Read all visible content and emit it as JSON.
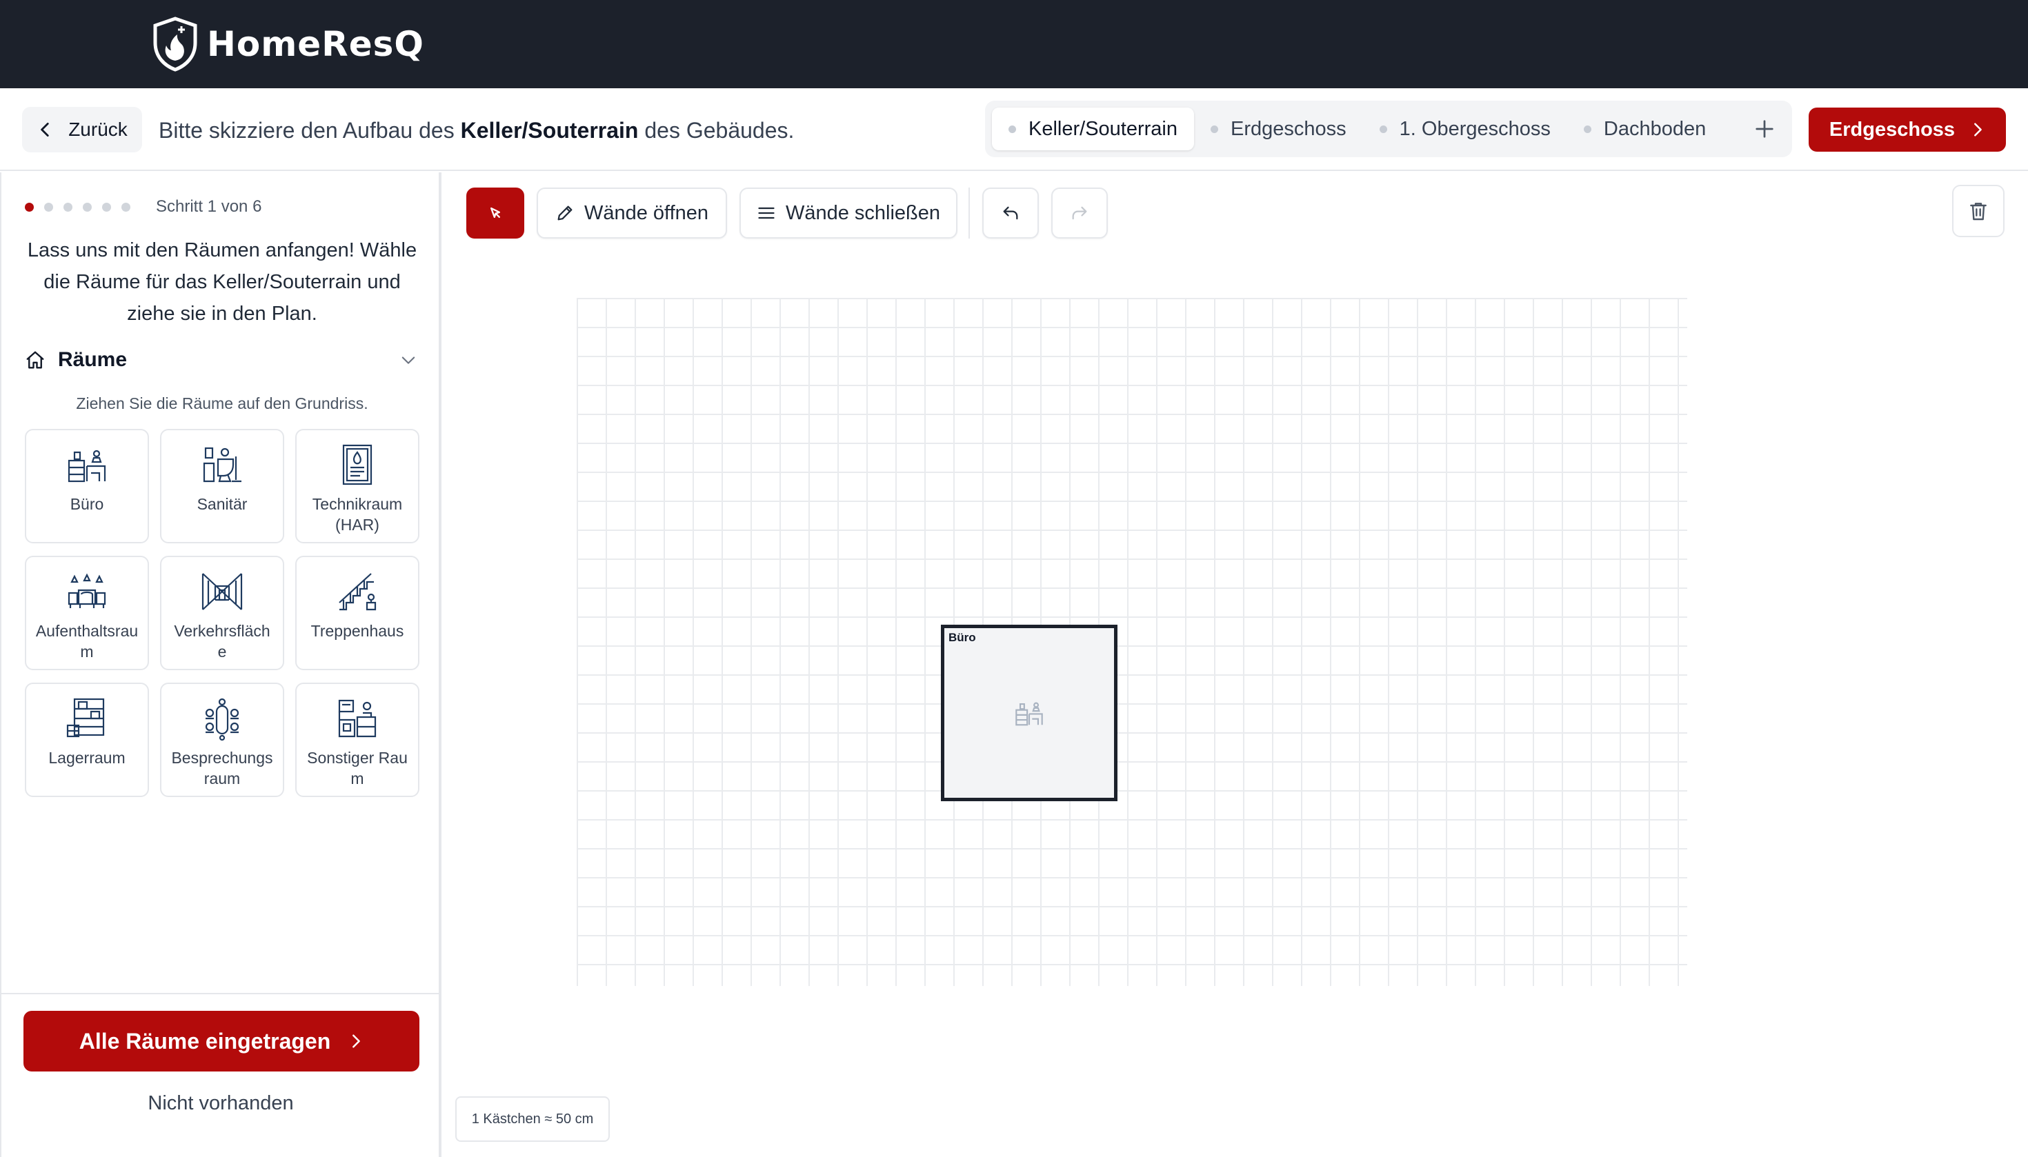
{
  "app": {
    "name": "HomeResQ"
  },
  "header": {
    "back_label": "Zurück",
    "prompt_before": "Bitte skizziere den Aufbau des ",
    "prompt_floor": "Keller/Souterrain",
    "prompt_after": " des Gebäudes.",
    "floors": [
      "Keller/Souterrain",
      "Erdgeschoss",
      "1. Obergeschoss",
      "Dachboden"
    ],
    "active_floor": "Keller/Souterrain",
    "next_label": "Erdgeschoss"
  },
  "sidebar": {
    "step_text": "Schritt 1 von 6",
    "step_current": 1,
    "step_total": 6,
    "intro": "Lass uns mit den Räumen anfangen! Wähle die Räume für das Keller/Souterrain und ziehe sie in den Plan.",
    "section_title": "Räume",
    "hint": "Ziehen Sie die Räume auf den Grundriss.",
    "rooms": [
      {
        "label": "Büro",
        "icon": "office-icon"
      },
      {
        "label": "Sanitär",
        "icon": "sanitary-icon"
      },
      {
        "label": "Technikraum (HAR)",
        "icon": "technical-room-icon"
      },
      {
        "label": "Aufenthaltsraum",
        "icon": "lounge-icon"
      },
      {
        "label": "Verkehrsfläche",
        "icon": "corridor-icon"
      },
      {
        "label": "Treppenhaus",
        "icon": "staircase-icon"
      },
      {
        "label": "Lagerraum",
        "icon": "storage-icon"
      },
      {
        "label": "Besprechungsraum",
        "icon": "meeting-room-icon"
      },
      {
        "label": "Sonstiger Raum",
        "icon": "other-room-icon"
      }
    ],
    "all_rooms_label": "Alle Räume eingetragen",
    "none_label": "Nicht vorhanden"
  },
  "toolbar": {
    "open_walls_label": "Wände öffnen",
    "close_walls_label": "Wände schließen"
  },
  "canvas": {
    "placed_room_label": "Büro",
    "scale_label": "1 Kästchen ≈ 50 cm"
  },
  "colors": {
    "brand_red": "#b30b0b",
    "appbar_dark": "#1c212b"
  }
}
